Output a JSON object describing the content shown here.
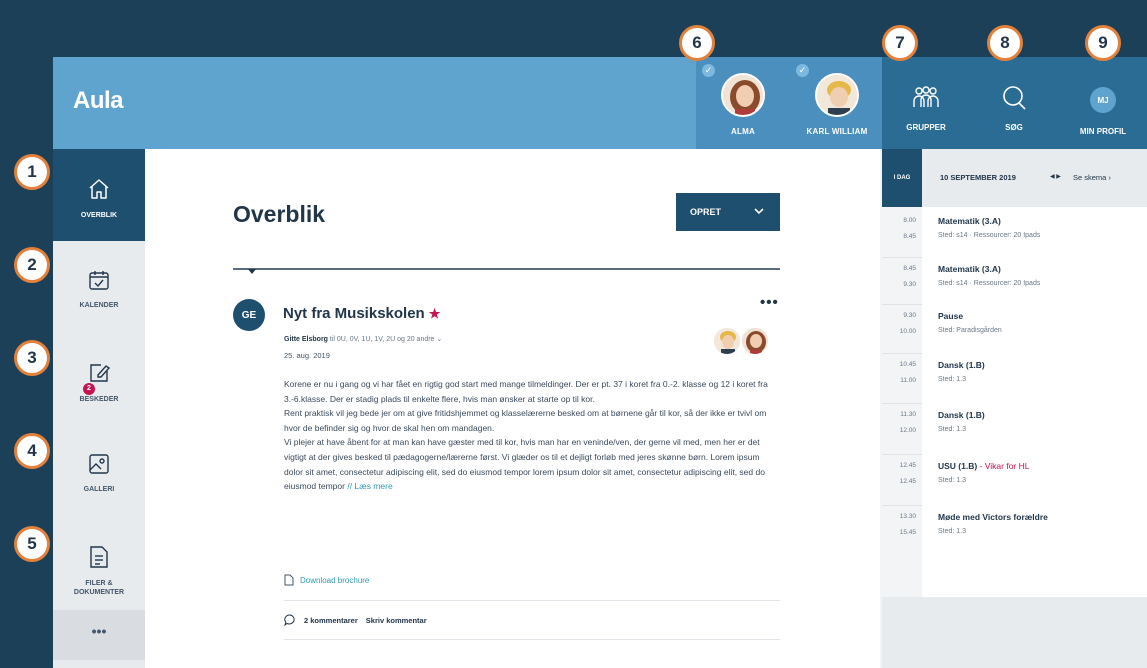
{
  "header": {
    "logo": "Aula",
    "children": [
      {
        "name": "ALMA"
      },
      {
        "name": "KARL WILLIAM"
      }
    ],
    "groups_label": "GRUPPER",
    "search_label": "SØG",
    "profile_initials": "MJ",
    "profile_label": "MIN PROFIL"
  },
  "sidebar": {
    "items": [
      {
        "label": "OVERBLIK",
        "icon": "home-icon"
      },
      {
        "label": "KALENDER",
        "icon": "calendar-icon"
      },
      {
        "label": "BESKEDER",
        "icon": "message-edit-icon",
        "badge": "2"
      },
      {
        "label": "GALLERI",
        "icon": "gallery-icon"
      },
      {
        "label_line1": "FILER &",
        "label_line2": "DOKUMENTER",
        "icon": "document-icon"
      }
    ],
    "more": "•••"
  },
  "main": {
    "title": "Overblik",
    "create_label": "OPRET",
    "post": {
      "avatar": "GE",
      "title": "Nyt fra Musikskolen",
      "star": "★",
      "more": "•••",
      "author": "Gitte Elsborg",
      "recipients": " til 0U, 0V, 1U, 1V, 2U og 20 andre ⌄",
      "date": "25. aug. 2019",
      "body": [
        "Korene er nu i gang og vi har fået en rigtig god start med mange tilmeldinger. Der er pt. 37 i koret fra 0.-2. klasse og 12 i koret fra 3.-6.klasse. Der er stadig plads til enkelte flere, hvis man ønsker at starte op til kor.",
        "Rent praktisk vil jeg bede jer om at give fritidshjemmet og klasselærerne besked om at børnene går til kor, så der ikke er tvivl om hvor de befinder sig og hvor de skal hen om mandagen.",
        "Vi plejer at have åbent for at man kan have gæster med til kor, hvis man har en veninde/ven, der gerne vil med, men her er det vigtigt at der gives besked til pædagogerne/lærerne først. Vi glæder os til et dejligt forløb med jeres skønne børn. Lorem ipsum dolor sit amet, consectetur adipiscing elit, sed do eiusmod tempor lorem ipsum dolor sit amet, consectetur adipiscing elit, sed do eiusmod tempor"
      ],
      "read_more": "// Læs mere",
      "download": "Download brochure",
      "comments": "2 kommentarer",
      "write_comment": "Skriv kommentar"
    }
  },
  "calendar": {
    "today": "I DAG",
    "date": "10 SEPTEMBER 2019",
    "arrows": "◀ ▶",
    "link": "Se skema ›",
    "events": [
      {
        "start": "8.00",
        "end": "8.45",
        "title": "Matematik (3.A)",
        "subtitle": "",
        "location": "Sted: s14 · Ressourcer: 20 Ipads"
      },
      {
        "start": "8.45",
        "end": "9.30",
        "title": "Matematik (3.A)",
        "subtitle": "",
        "location": "Sted: s14 · Ressourcer: 20 Ipads"
      },
      {
        "start": "9.30",
        "end": "10.00",
        "title": "Pause",
        "subtitle": "",
        "location": "Sted: Paradisgården"
      },
      {
        "start": "10.45",
        "end": "11.00",
        "title": "Dansk (1.B)",
        "subtitle": "",
        "location": "Sted: 1.3"
      },
      {
        "start": "11.30",
        "end": "12.00",
        "title": "Dansk (1.B)",
        "subtitle": "",
        "location": "Sted: 1.3"
      },
      {
        "start": "12.45",
        "end": "12.45",
        "title": "USU (1.B)",
        "subtitle": " - Vikar for HL",
        "location": "Sted: 1.3"
      },
      {
        "start": "13.30",
        "end": "15.45",
        "title": "Møde med Victors forældre",
        "subtitle": "",
        "location": "Sted: 1.3"
      }
    ]
  },
  "annotations": [
    "1",
    "2",
    "3",
    "4",
    "5",
    "6",
    "7",
    "8",
    "9"
  ],
  "colors": {
    "header": "#5fa4cf",
    "dark_blue": "#1f4f6e",
    "accent_red": "#c4134f",
    "link_teal": "#2f9ab0",
    "annotation_orange": "#e3813b"
  }
}
